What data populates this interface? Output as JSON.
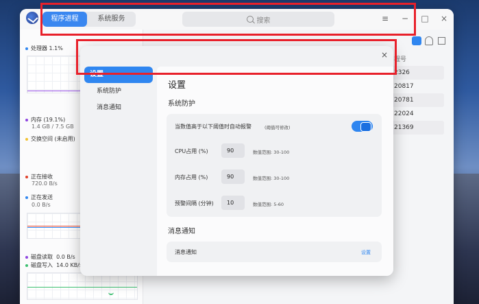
{
  "app": {
    "tabs": [
      "程序进程",
      "系统服务"
    ],
    "active_tab": "程序进程",
    "search_placeholder": "搜索",
    "accent_color": "#3a87f0",
    "window_controls": [
      "menu-icon",
      "minimize-icon",
      "maximize-icon",
      "close-icon"
    ]
  },
  "monitor": {
    "cpu_label": "处理器",
    "cpu_value": "1.1%",
    "memory_label": "内存 (19.1%)",
    "memory_value": "1.4 GB / 7.5 GB",
    "swap_label": "交换空间 (未启用)",
    "net_receive_label": "正在接收",
    "net_receive_value": "720.0 B/s",
    "net_send_label": "正在发送",
    "net_send_value": "0.0 B/s",
    "disk_read_label": "磁盘读取",
    "disk_read_value": "0.0 B/s",
    "disk_write_label": "磁盘写入",
    "disk_write_value": "14.0 KB/s",
    "colors": {
      "cpu": "#2f86f0",
      "memory": "#8e44e0",
      "swap": "#f2c230",
      "receive": "#e0402a",
      "send": "#2f86f0",
      "disk_read": "#8e44e0",
      "disk_write": "#3cbf70"
    }
  },
  "process_list": {
    "column_header": "程号",
    "pids": [
      "2326",
      "20817",
      "20781",
      "22024",
      "21369"
    ]
  },
  "dialog": {
    "nav": {
      "root": "设置",
      "items": [
        "系统防护",
        "消息通知"
      ]
    },
    "title": "设置",
    "section_protection": "系统防护",
    "alert_label": "当数值高于以下阈值时自动报警",
    "alert_hint": "(阈值可修改)",
    "alert_enabled": true,
    "rows": [
      {
        "label": "CPU占用 (%)",
        "value": "90",
        "range": "数值范围: 30-100"
      },
      {
        "label": "内存占用 (%)",
        "value": "90",
        "range": "数值范围: 30-100"
      },
      {
        "label": "预警间隔 (分钟)",
        "value": "10",
        "range": "数值范围: 5-60"
      }
    ],
    "section_notify": "消息通知",
    "notify_label": "消息通知",
    "notify_link": "设置"
  }
}
